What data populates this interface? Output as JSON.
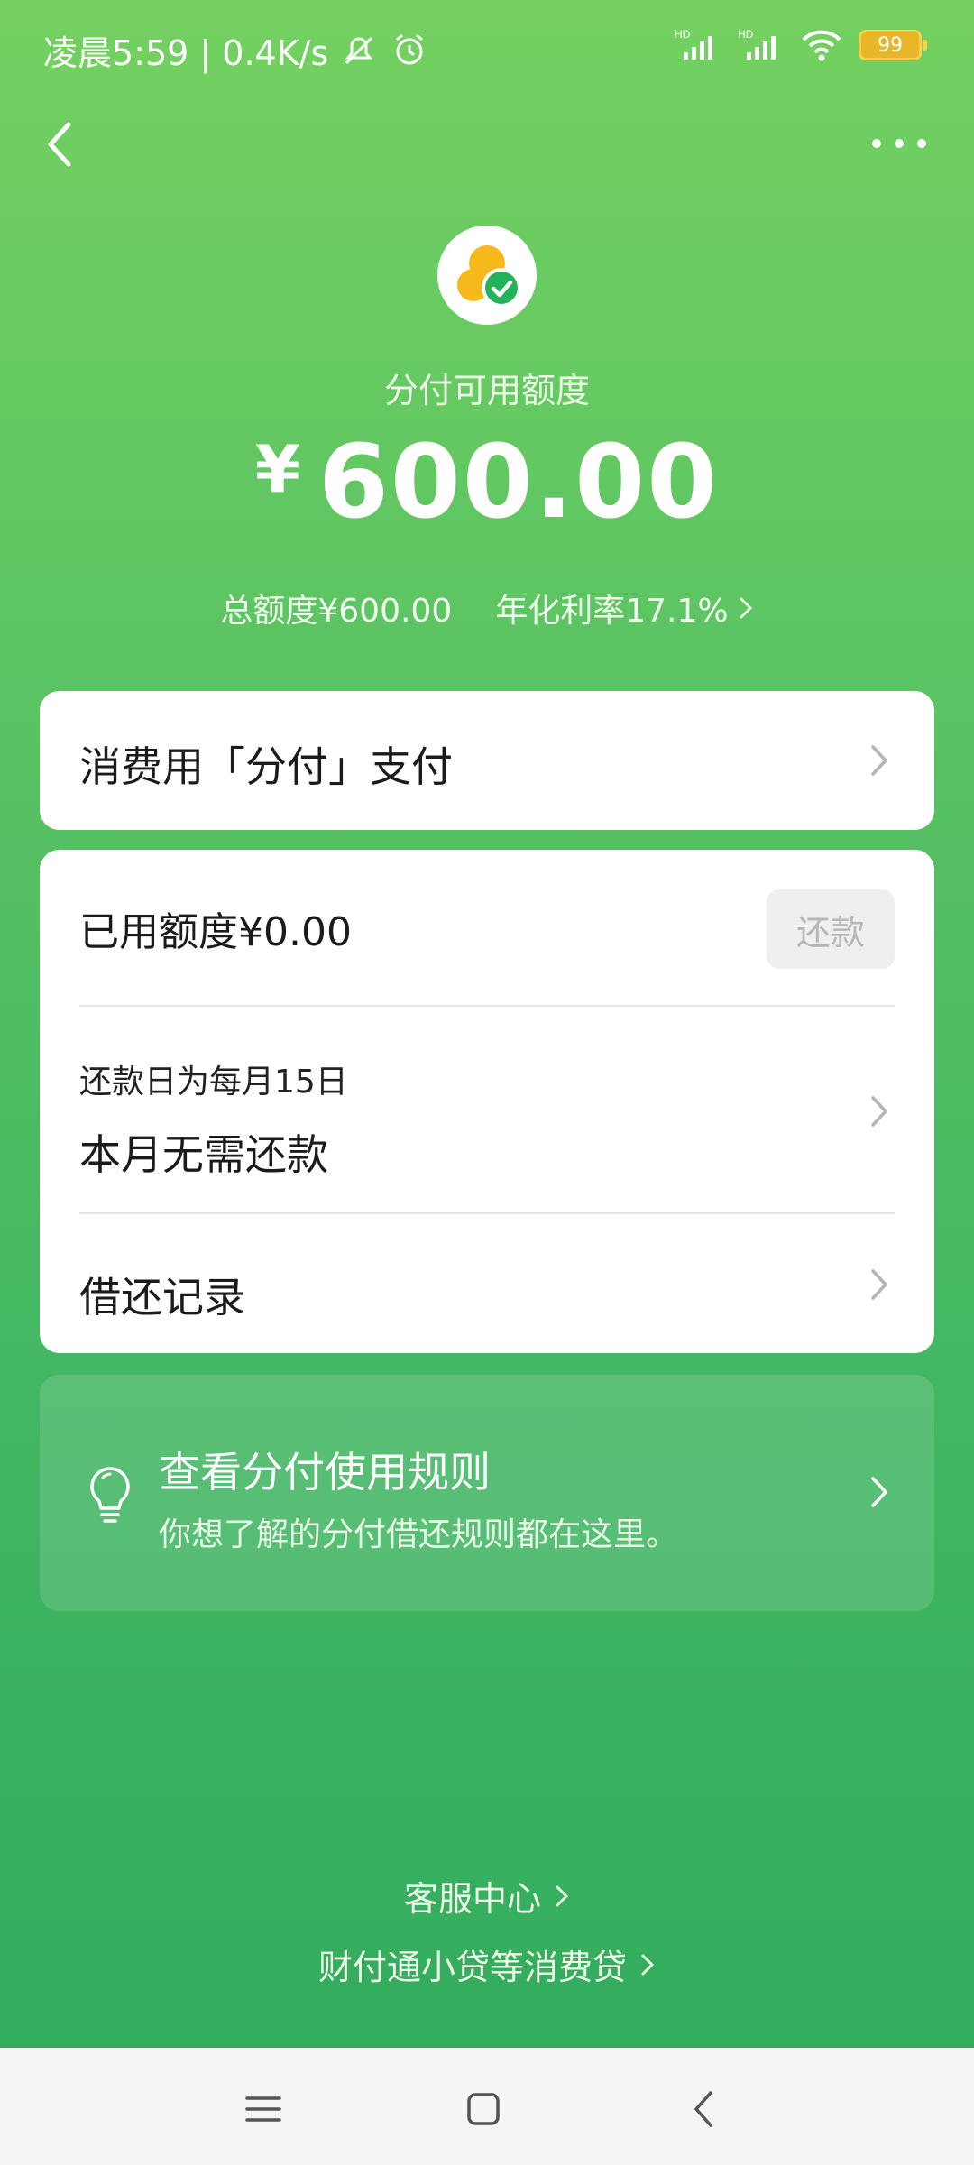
{
  "status_bar": {
    "time_speed": "凌晨5:59 | 0.4K/s",
    "battery": "99",
    "icons": [
      "mute-bell-icon",
      "alarm-icon",
      "signal-hd-icon",
      "signal-hd-icon",
      "wifi-icon",
      "battery-icon"
    ]
  },
  "header": {
    "back_icon": "back-arrow-icon",
    "more_icon": "more-dots-icon"
  },
  "summary": {
    "label": "分付可用额度",
    "currency": "¥",
    "amount": "600.00",
    "total_limit": "总额度¥600.00",
    "annual_rate": "年化利率17.1%"
  },
  "pay_card": {
    "label": "消费用「分付」支付"
  },
  "main_card": {
    "used_limit": "已用额度¥0.00",
    "repay_button": "还款",
    "due_day": "还款日为每月15日",
    "due_status": "本月无需还款",
    "records": "借还记录"
  },
  "rules_card": {
    "title": "查看分付使用规则",
    "subtitle": "你想了解的分付借还规则都在这里。"
  },
  "footer": {
    "service": "客服中心",
    "loan": "财付通小贷等消费贷"
  },
  "colors": {
    "bg_top": "#74d161",
    "bg_bottom": "#32ad5e",
    "logo_yellow": "#f6b81a",
    "logo_green": "#22b35a"
  }
}
